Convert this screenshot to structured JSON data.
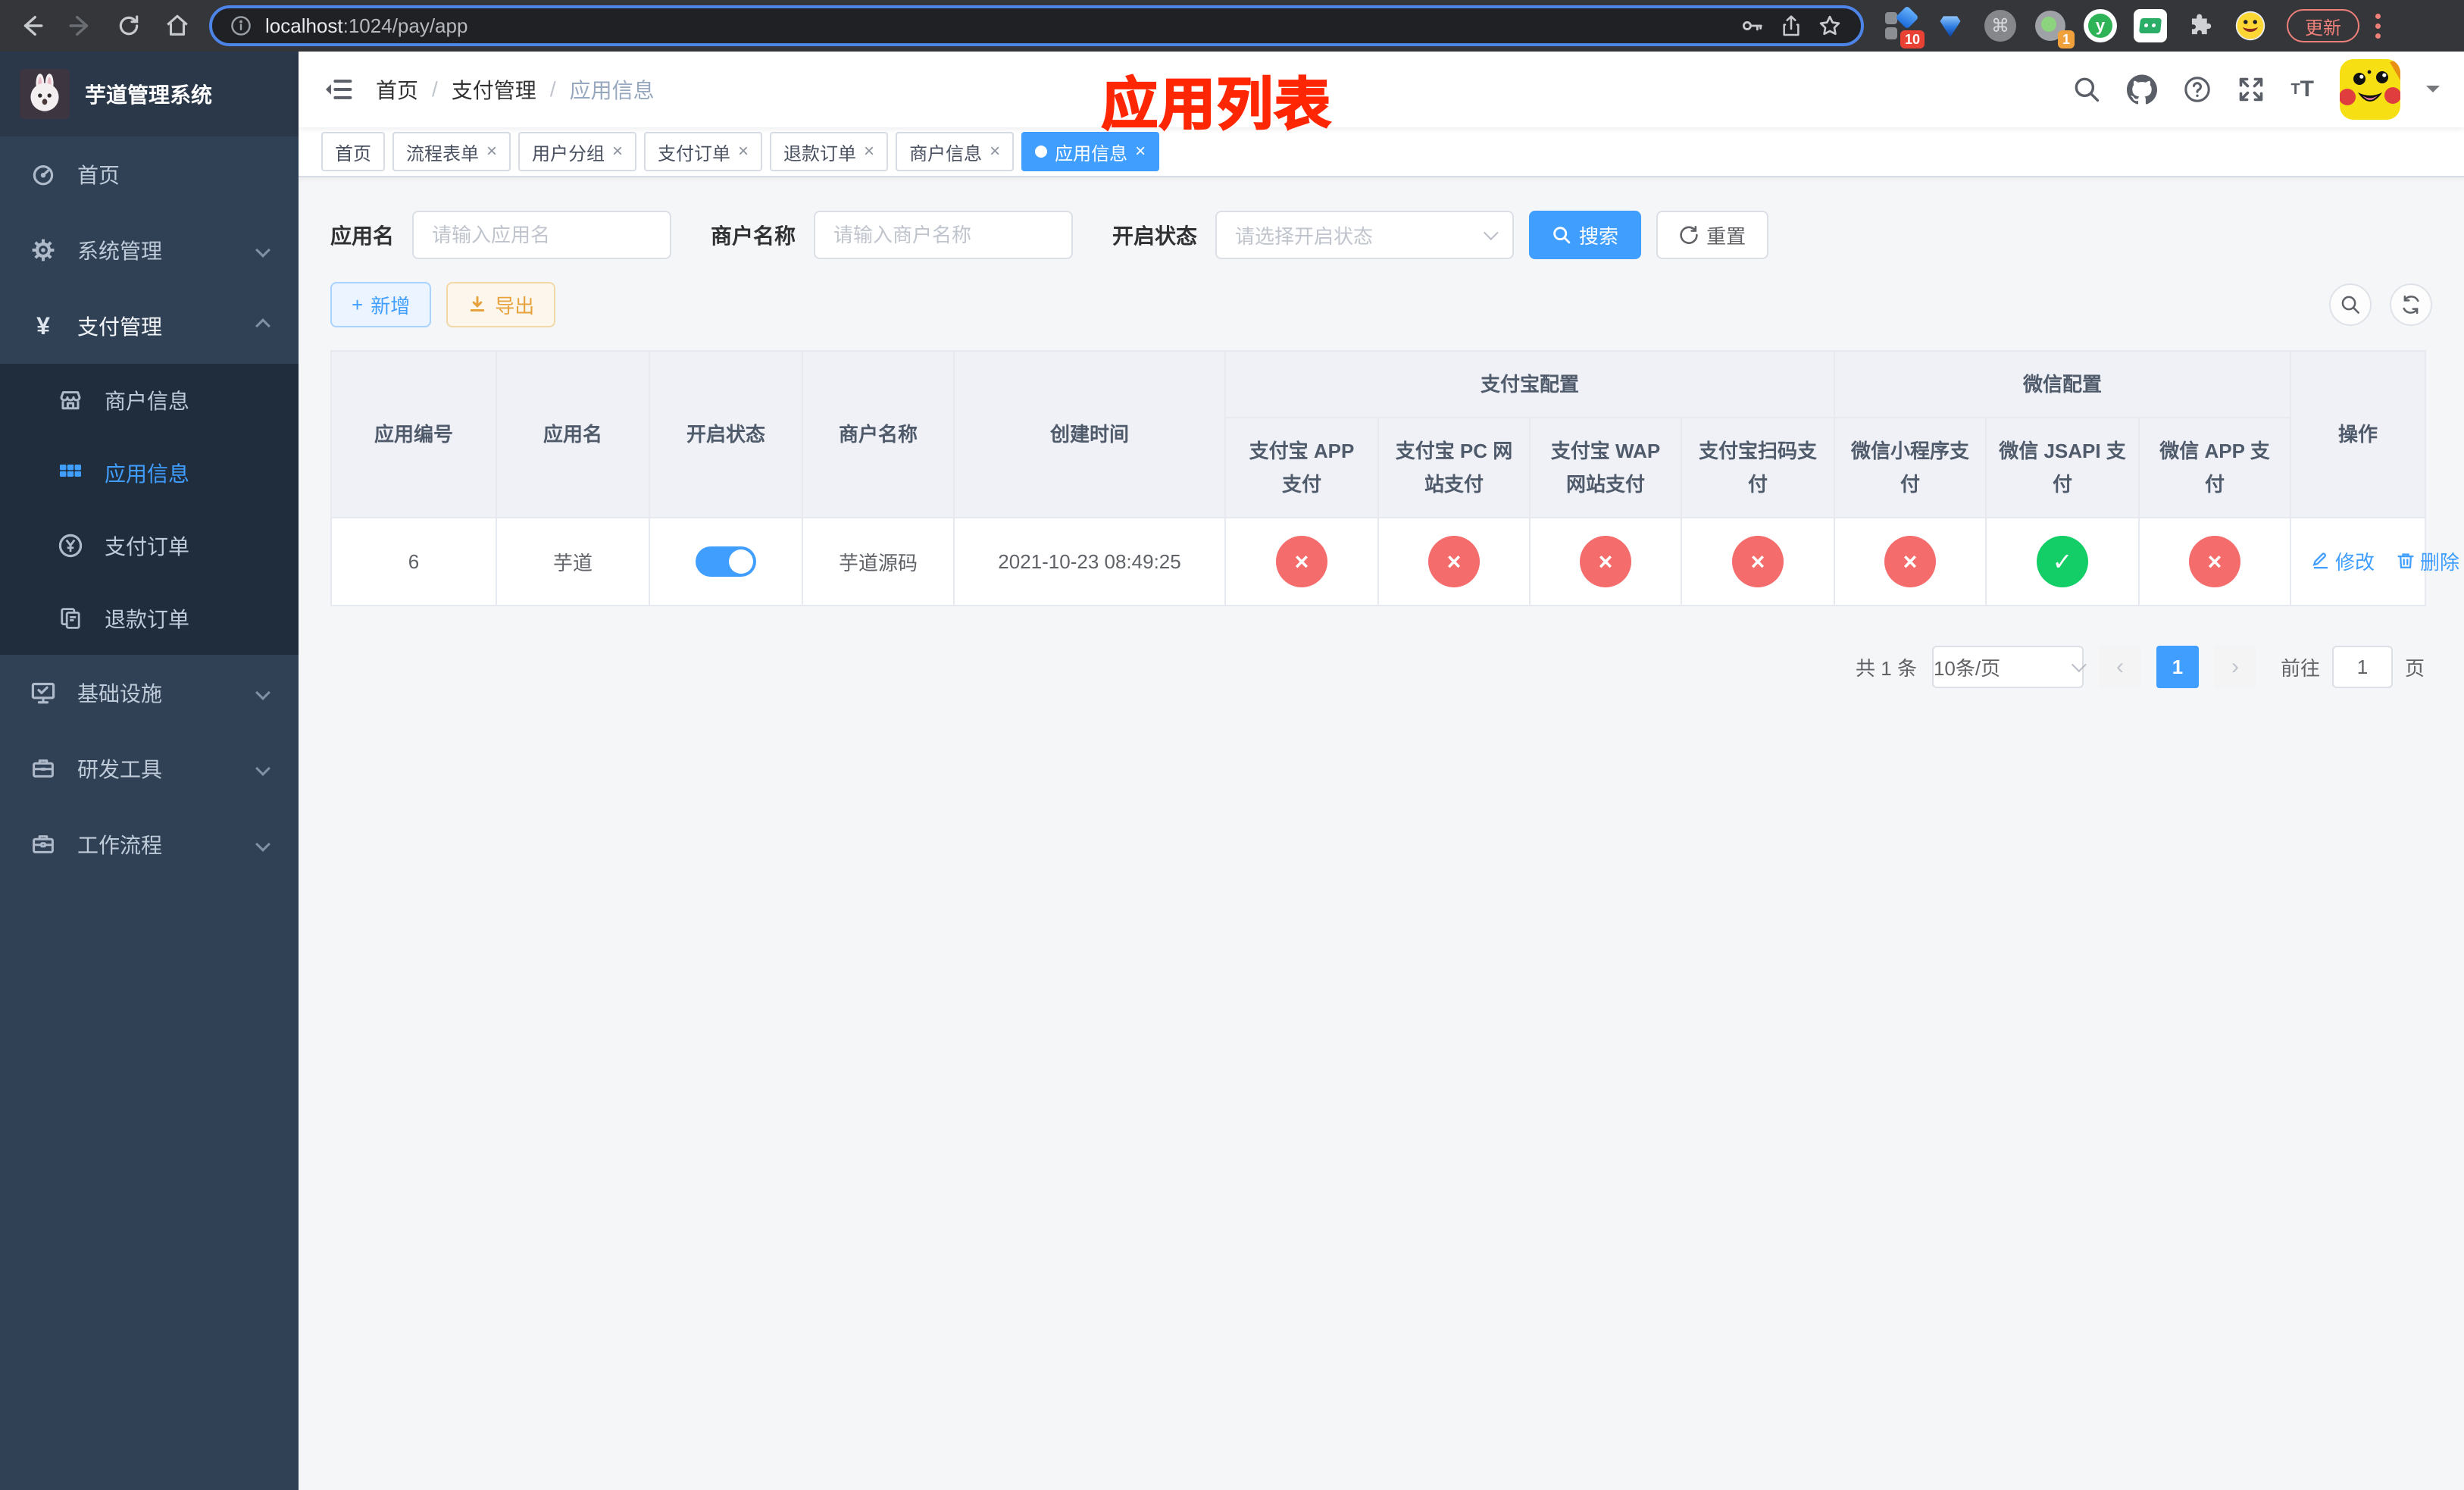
{
  "browser": {
    "url_host": "localhost",
    "url_path": ":1024/pay/app",
    "ext_badge_red": "10",
    "ext_badge_orange": "1",
    "vue_letter": "y",
    "cmd_glyph": "⌘",
    "update_label": "更新"
  },
  "sidebar": {
    "title": "芋道管理系统",
    "items": [
      {
        "label": "首页",
        "icon": "dashboard-icon"
      },
      {
        "label": "系统管理",
        "icon": "gear-icon"
      },
      {
        "label": "支付管理",
        "icon": "yen-icon"
      }
    ],
    "submenu": [
      {
        "label": "商户信息",
        "icon": "shop-icon"
      },
      {
        "label": "应用信息",
        "icon": "grid-icon",
        "active": true
      },
      {
        "label": "支付订单",
        "icon": "yen-circle-icon"
      },
      {
        "label": "退款订单",
        "icon": "document-icon"
      }
    ],
    "items2": [
      {
        "label": "基础设施",
        "icon": "monitor-icon"
      },
      {
        "label": "研发工具",
        "icon": "toolbox-icon"
      },
      {
        "label": "工作流程",
        "icon": "workflow-icon"
      }
    ]
  },
  "navbar": {
    "breadcrumb": [
      "首页",
      "支付管理",
      "应用信息"
    ],
    "separator": "/"
  },
  "annotation": {
    "text": "应用列表"
  },
  "tags": [
    {
      "label": "首页"
    },
    {
      "label": "流程表单"
    },
    {
      "label": "用户分组"
    },
    {
      "label": "支付订单"
    },
    {
      "label": "退款订单"
    },
    {
      "label": "商户信息"
    },
    {
      "label": "应用信息"
    }
  ],
  "tag_close_glyph": "×",
  "filters": {
    "app_name_label": "应用名",
    "app_name_placeholder": "请输入应用名",
    "merchant_label": "商户名称",
    "merchant_placeholder": "请输入商户名称",
    "status_label": "开启状态",
    "status_placeholder": "请选择开启状态",
    "search_label": "搜索",
    "reset_label": "重置"
  },
  "toolbar": {
    "add_label": "新增",
    "export_label": "导出"
  },
  "table": {
    "col_id": "应用编号",
    "col_name": "应用名",
    "col_status": "开启状态",
    "col_merchant": "商户名称",
    "col_created": "创建时间",
    "group_alipay": "支付宝配置",
    "group_wechat": "微信配置",
    "alipay_cols": [
      "支付宝 APP 支付",
      "支付宝 PC 网站支付",
      "支付宝 WAP 网站支付",
      "支付宝扫码支付"
    ],
    "wechat_cols": [
      "微信小程序支付",
      "微信 JSAPI 支付",
      "微信 APP 支付"
    ],
    "col_action": "操作",
    "row": {
      "id": "6",
      "name": "芋道",
      "enabled": true,
      "merchant": "芋道源码",
      "created": "2021-10-23 08:49:25",
      "badges": [
        "cross",
        "cross",
        "cross",
        "cross",
        "cross",
        "check",
        "cross"
      ],
      "edit_label": "修改",
      "delete_label": "删除"
    }
  },
  "pagination": {
    "total": "共 1 条",
    "page_size": "10条/页",
    "page": "1",
    "goto_label": "前往",
    "goto_value": "1",
    "page_unit": "页"
  },
  "colors": {
    "primary": "#409EFF",
    "danger": "#F56C6C",
    "success": "#13CE66",
    "warning": "#E6A23C",
    "annotation_red": "#FF2604",
    "sidebar_bg": "#304156",
    "submenu_bg": "#1F2D3D"
  }
}
